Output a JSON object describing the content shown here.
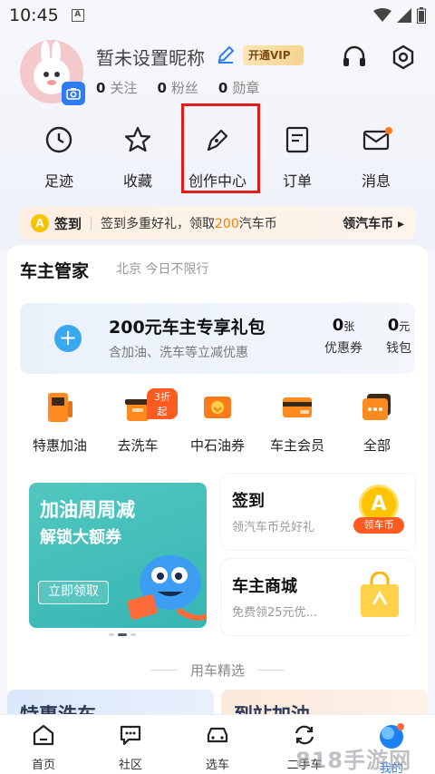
{
  "status_bar": {
    "time": "10:45",
    "notification_letter": "A"
  },
  "profile": {
    "nickname": "暂未设置昵称",
    "vip_label": "开通VIP",
    "stats": [
      {
        "count": "0",
        "label": "关注"
      },
      {
        "count": "0",
        "label": "粉丝"
      },
      {
        "count": "0",
        "label": "勋章"
      }
    ]
  },
  "quick_actions": [
    {
      "label": "足迹",
      "icon": "clock-icon"
    },
    {
      "label": "收藏",
      "icon": "star-icon"
    },
    {
      "label": "创作中心",
      "icon": "pen-icon"
    },
    {
      "label": "订单",
      "icon": "order-icon"
    },
    {
      "label": "消息",
      "icon": "mail-icon"
    }
  ],
  "sign_bar": {
    "coin": "A",
    "title": "签到",
    "desc_before": "签到多重好礼，领取",
    "desc_highlight": "200",
    "desc_after": "汽车币",
    "link": "领汽车币"
  },
  "car_owner": {
    "title": "车主管家",
    "subtitle": "北京  今日不限行",
    "gift": {
      "title": "200元车主专享礼包",
      "sub": "含加油、洗车等立减优惠",
      "coupons": {
        "num": "0",
        "unit": "张",
        "label": "优惠券"
      },
      "wallet": {
        "num": "0",
        "unit": "元",
        "label": "钱包"
      }
    },
    "services": [
      {
        "label": "特惠加油",
        "icon": "fuel-pump-icon"
      },
      {
        "label": "去洗车",
        "icon": "car-wash-icon",
        "tag": "3折起"
      },
      {
        "label": "中石油券",
        "icon": "coupon-icon"
      },
      {
        "label": "车主会员",
        "icon": "vip-card-icon"
      },
      {
        "label": "全部",
        "icon": "more-icon"
      }
    ]
  },
  "promo": {
    "left": {
      "line1": "加油周周减",
      "line2": "解锁大额券",
      "button": "立即领取"
    },
    "signin": {
      "title": "签到",
      "sub": "领汽车币兑好礼",
      "badge": "领车币",
      "coin": "A"
    },
    "mall": {
      "title": "车主商城",
      "sub": "免费领25元优..."
    }
  },
  "section_divider": "用车精选",
  "peek": {
    "left": "特惠洗车",
    "right": "到站加油"
  },
  "tabbar": [
    {
      "label": "首页",
      "icon": "home-icon"
    },
    {
      "label": "社区",
      "icon": "chat-icon"
    },
    {
      "label": "选车",
      "icon": "car-icon"
    },
    {
      "label": "二手车",
      "icon": "refresh-icon"
    },
    {
      "label": "我的",
      "icon": "profile-icon",
      "active": true
    }
  ],
  "watermark": "818手游网"
}
